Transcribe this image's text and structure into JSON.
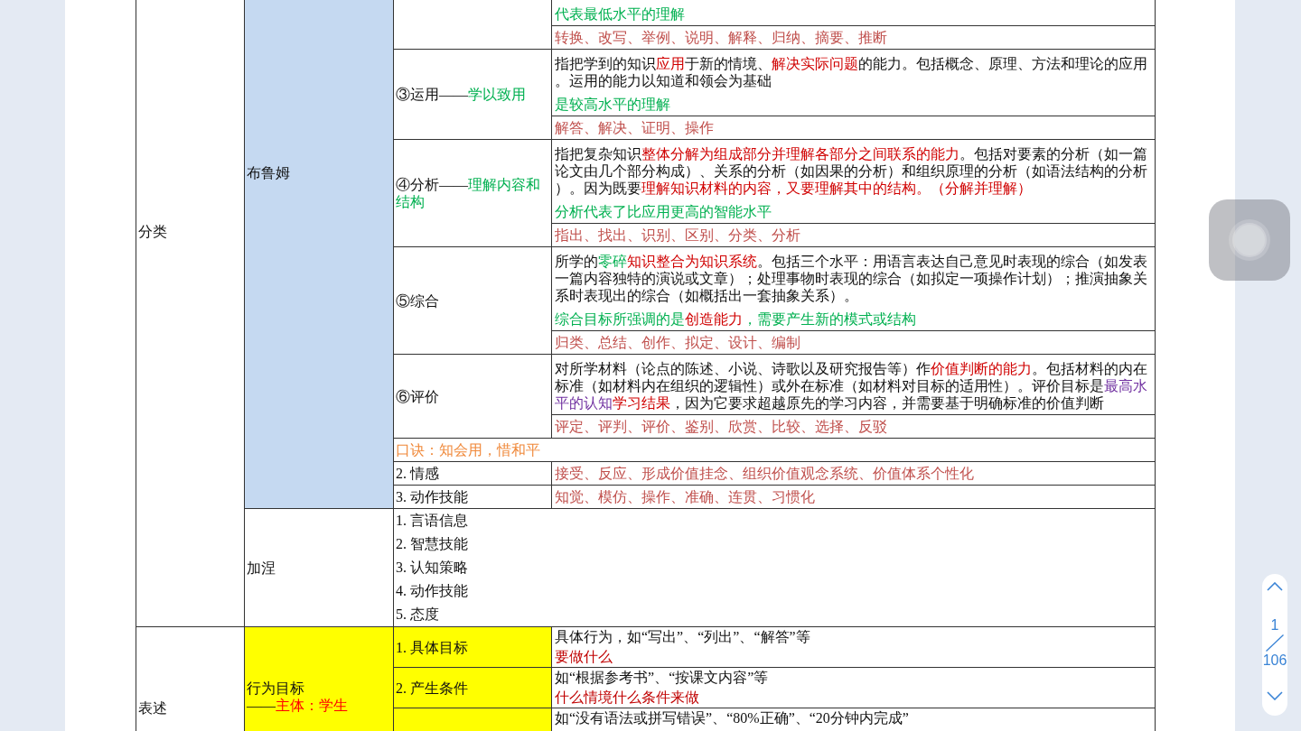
{
  "table": {
    "sections": [
      {
        "label": "分类",
        "subsections": [
          {
            "label": [
              [
                {
                  "text": "布鲁姆"
                }
              ]
            ],
            "color": "#c5d9f1",
            "rows": [
              {
                "kind": "level",
                "description": [
                  [
                    {
                      "text": "代表最低水平的理解",
                      "color": "#00b050"
                    }
                  ]
                ],
                "verbs": "转换、改写、举例、说明、解释、归纳、摘要、推断"
              },
              {
                "kind": "level",
                "title": [
                  {
                    "text": "③运用——"
                  },
                  {
                    "text": "学以致用",
                    "color": "#00b050"
                  }
                ],
                "description": [
                  [
                    {
                      "text": "指把学到的知识"
                    },
                    {
                      "text": "应用",
                      "color": "#d00000"
                    },
                    {
                      "text": "于新的情境、"
                    },
                    {
                      "text": "解决实际问题",
                      "color": "#d00000"
                    },
                    {
                      "text": "的能力。包括概念、原理、方法和理论的应用。运用的能力以知道和领会为基础"
                    }
                  ],
                  [
                    {
                      "text": "是较高水平的理解",
                      "color": "#00b050"
                    }
                  ]
                ],
                "verbs": "解答、解决、证明、操作"
              },
              {
                "kind": "level",
                "title": [
                  {
                    "text": "④分析——"
                  },
                  {
                    "text": "理解内容和结构",
                    "color": "#00b050"
                  }
                ],
                "description": [
                  [
                    {
                      "text": "指把复杂知识"
                    },
                    {
                      "text": "整体分解为组成部分并理解各部分之间联系的能力",
                      "color": "#d00000"
                    },
                    {
                      "text": "。包括对要素的分析（如一篇论文由几个部分构成）、关系的分析（如因果的分析）和组织原理的分析（如语法结构的分析）。因为既要"
                    },
                    {
                      "text": "理解知识材料的内容，又要理解其中的结构。（分解并理解）",
                      "color": "#d00000"
                    }
                  ],
                  [
                    {
                      "text": "分析代表了比应用更高的智能水平",
                      "color": "#00b050"
                    }
                  ]
                ],
                "verbs": "指出、找出、识别、区别、分类、分析"
              },
              {
                "kind": "level",
                "title": [
                  {
                    "text": "⑤综合"
                  }
                ],
                "description": [
                  [
                    {
                      "text": "所学的"
                    },
                    {
                      "text": "零碎",
                      "color": "#00b050"
                    },
                    {
                      "text": "知识整合为知识系统",
                      "color": "#d00000"
                    },
                    {
                      "text": "。包括三个水平：用语言表达自己意见时表现的综合（如发表一篇内容独特的演说或文章）；处理事物时表现的综合（如拟定一项操作计划）；推演抽象关系时表现出的综合（如概括出一套抽象关系）。"
                    }
                  ],
                  [
                    {
                      "text": "综合目标所强调的是",
                      "color": "#00b050"
                    },
                    {
                      "text": "创造能力",
                      "color": "#d00000"
                    },
                    {
                      "text": "，需要产生新的模式或结构",
                      "color": "#00b050"
                    }
                  ]
                ],
                "verbs": "归类、总结、创作、拟定、设计、编制"
              },
              {
                "kind": "level",
                "title": [
                  {
                    "text": "⑥评价"
                  }
                ],
                "description": [
                  [
                    {
                      "text": "对所学材料（论点的陈述、小说、诗歌以及研究报告等）作"
                    },
                    {
                      "text": "价值判断的能力",
                      "color": "#d00000"
                    },
                    {
                      "text": "。包括材料的内在标准（如材料内在组织的逻辑性）或外在标准（如材料对目标的适用性）。评价目标是"
                    },
                    {
                      "text": "最高水平的认知",
                      "color": "#7030a0"
                    },
                    {
                      "text": "学习结果",
                      "color": "#d00000"
                    },
                    {
                      "text": "，因为它要求超越原先的学习内容，并需要基于明确标准的价值判断"
                    }
                  ]
                ],
                "verbs": "评定、评判、评价、鉴别、欣赏、比较、选择、反驳"
              },
              {
                "kind": "note",
                "text": "口诀：知会用，惜和平"
              },
              {
                "kind": "domain",
                "title": "2. 情感",
                "verbs": "接受、反应、形成价值挂念、组织价值观念系统、价值体系个性化"
              },
              {
                "kind": "domain",
                "title": "3. 动作技能",
                "verbs": "知觉、模仿、操作、准确、连贯、习惯化"
              }
            ]
          },
          {
            "label": [
              [
                {
                  "text": "加涅"
                }
              ]
            ],
            "color": "#ffffff",
            "rows": [
              {
                "kind": "list",
                "items": [
                  "1. 言语信息",
                  "2. 智慧技能",
                  "3. 认知策略",
                  "4. 动作技能",
                  "5. 态度"
                ]
              }
            ]
          }
        ]
      },
      {
        "label": "表述",
        "subsections": [
          {
            "label": [
              [
                {
                  "text": "行为目标"
                }
              ],
              [
                {
                  "text": "——"
                },
                {
                  "text": "主体：学生",
                  "color": "#ff0000"
                }
              ]
            ],
            "color": "#ffff00",
            "rows": [
              {
                "kind": "goal",
                "title": "1. 具体目标",
                "color": "#ffff00",
                "description": [
                  [
                    {
                      "text": "具体行为，如“写出”、“列出”、“解答”等"
                    }
                  ],
                  [
                    {
                      "text": "要做什么",
                      "color": "#c00000"
                    }
                  ]
                ]
              },
              {
                "kind": "goal",
                "title": "2. 产生条件",
                "color": "#ffff00",
                "description": [
                  [
                    {
                      "text": "如“根据参考书”、“按课文内容”等"
                    }
                  ],
                  [
                    {
                      "text": "什么情境什么条件来做",
                      "color": "#c00000"
                    }
                  ]
                ]
              },
              {
                "kind": "goal",
                "color": "#ffff00",
                "description": [
                  [
                    {
                      "text": "如“没有语法或拼写错误”、“80%正确”、“20分钟内完成”"
                    }
                  ]
                ]
              }
            ]
          }
        ]
      }
    ]
  },
  "pager": {
    "current": "1",
    "total": "106"
  }
}
